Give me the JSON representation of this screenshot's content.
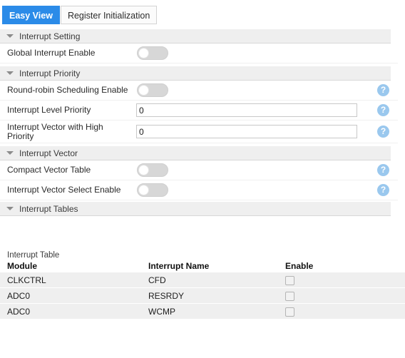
{
  "tabs": [
    {
      "label": "Easy View",
      "active": true
    },
    {
      "label": "Register Initialization",
      "active": false
    }
  ],
  "sections": [
    {
      "title": "Interrupt Setting",
      "caret_icon": "caret-down-icon",
      "rows": [
        {
          "label": "Global Interrupt Enable",
          "control": "toggle",
          "value": "off",
          "help": false
        }
      ]
    },
    {
      "title": "Interrupt Priority",
      "caret_icon": "caret-down-icon",
      "rows": [
        {
          "label": "Round-robin Scheduling Enable",
          "control": "toggle",
          "value": "off",
          "help": true
        },
        {
          "label": "Interrupt Level Priority",
          "control": "input",
          "value": "0",
          "help": true
        },
        {
          "label": "Interrupt Vector with High Priority",
          "control": "input",
          "value": "0",
          "help": true
        }
      ]
    },
    {
      "title": "Interrupt Vector",
      "caret_icon": "caret-down-icon",
      "rows": [
        {
          "label": "Compact Vector Table",
          "control": "toggle",
          "value": "off",
          "help": true
        },
        {
          "label": "Interrupt Vector Select Enable",
          "control": "toggle",
          "value": "off",
          "help": true
        }
      ]
    },
    {
      "title": "Interrupt Tables",
      "caret_icon": "caret-down-icon",
      "rows": []
    }
  ],
  "table": {
    "caption": "Interrupt Table",
    "columns": [
      "Module",
      "Interrupt Name",
      "Enable"
    ],
    "rows": [
      {
        "module": "CLKCTRL",
        "name": "CFD",
        "enable": false
      },
      {
        "module": "ADC0",
        "name": "RESRDY",
        "enable": false
      },
      {
        "module": "ADC0",
        "name": "WCMP",
        "enable": false
      }
    ]
  },
  "help_icon_glyph": "?",
  "colors": {
    "tab_active_bg": "#2b8be8",
    "section_header_bg": "#efefef",
    "help_icon_bg": "#9ac8ee",
    "table_row_bg": "#efefef"
  }
}
